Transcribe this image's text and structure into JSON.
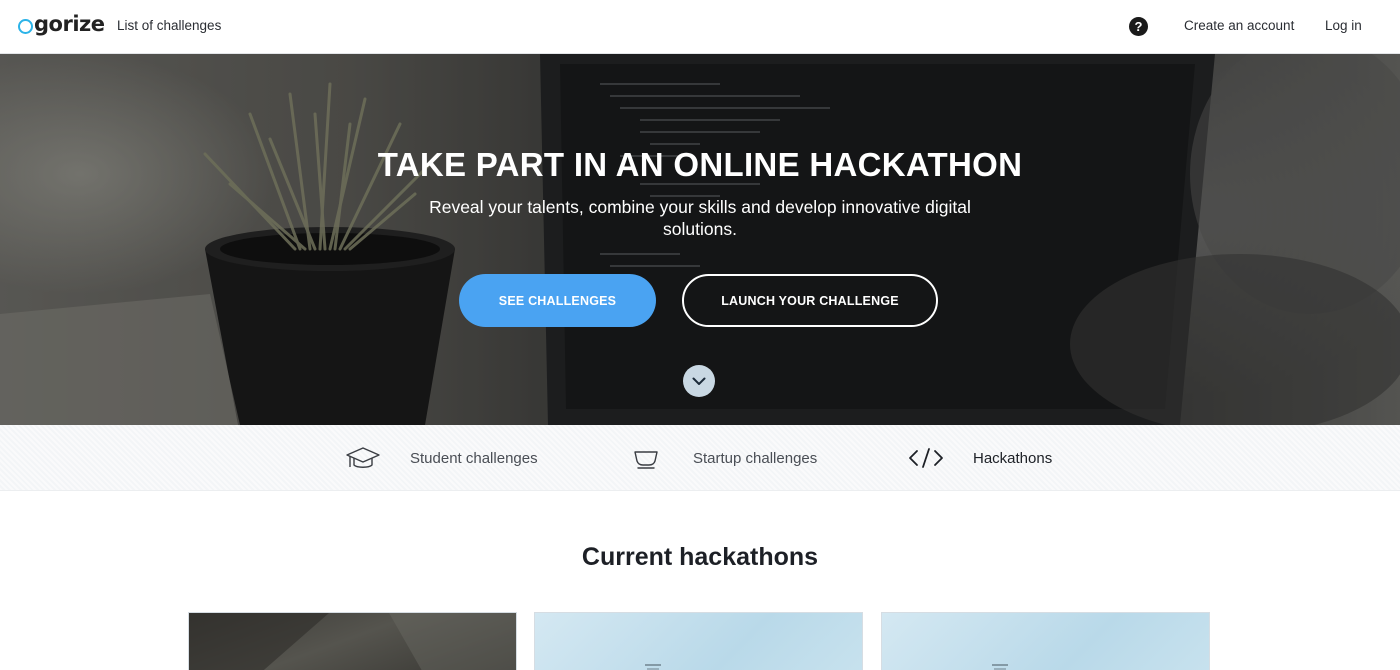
{
  "brand": {
    "logo_text": "gorize"
  },
  "nav": {
    "list_of_challenges": "List of challenges",
    "help_glyph": "?",
    "create_account": "Create an account",
    "log_in": "Log in"
  },
  "hero": {
    "title": "TAKE PART IN AN ONLINE HACKATHON",
    "subtitle": "Reveal your talents, combine your skills and develop innovative digital solutions.",
    "primary_button": "SEE CHALLENGES",
    "secondary_button": "LAUNCH YOUR CHALLENGE",
    "primary_color": "#4aa3f2"
  },
  "categories": [
    {
      "label": "Student challenges",
      "icon": "graduation-cap-icon"
    },
    {
      "label": "Startup challenges",
      "icon": "coffee-cup-icon"
    },
    {
      "label": "Hackathons",
      "icon": "code-brackets-icon"
    }
  ],
  "section": {
    "title": "Current hackathons"
  }
}
